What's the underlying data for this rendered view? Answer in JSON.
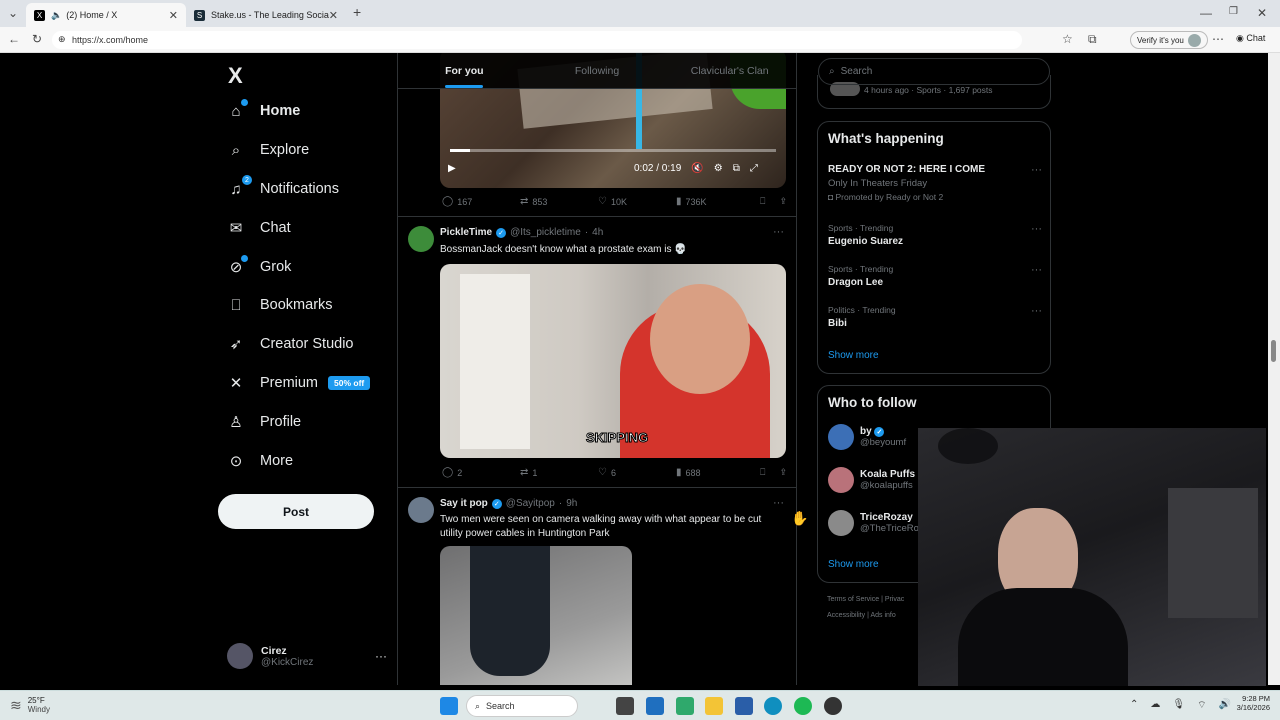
{
  "browser": {
    "tabs": [
      {
        "title": "(2) Home / X",
        "icon": "x-logo-icon"
      },
      {
        "title": "Stake.us - The Leading Social Casi...",
        "icon": "stake-icon"
      }
    ],
    "url": "https://x.com/home",
    "verify_label": "Verify it's you",
    "chat_label": "Chat"
  },
  "nav": {
    "logo": "X",
    "items": [
      {
        "label": "Home",
        "icon": "home-icon"
      },
      {
        "label": "Explore",
        "icon": "search-icon"
      },
      {
        "label": "Notifications",
        "icon": "bell-icon",
        "badge": "2"
      },
      {
        "label": "Chat",
        "icon": "mail-icon"
      },
      {
        "label": "Grok",
        "icon": "grok-icon"
      },
      {
        "label": "Bookmarks",
        "icon": "bookmark-icon"
      },
      {
        "label": "Creator Studio",
        "icon": "rocket-icon"
      },
      {
        "label": "Premium",
        "icon": "x-icon",
        "tag": "50% off"
      },
      {
        "label": "Profile",
        "icon": "person-icon"
      },
      {
        "label": "More",
        "icon": "more-circle-icon"
      }
    ],
    "post_label": "Post",
    "account": {
      "name": "Cirez",
      "handle": "@KickCirez"
    }
  },
  "feed": {
    "tabs": [
      "For you",
      "Following",
      "Clavicular's Clan"
    ],
    "video_time": "0:02 / 0:19",
    "posts": [
      {
        "stats": {
          "replies": "167",
          "reposts": "853",
          "likes": "10K",
          "views": "736K"
        }
      },
      {
        "name": "PickleTime",
        "handle": "@Its_pickletime",
        "time": "4h",
        "text": "BossmanJack doesn't know what a prostate exam is 💀",
        "caption": "SKIPPING",
        "stats": {
          "replies": "2",
          "reposts": "1",
          "likes": "6",
          "views": "688"
        }
      },
      {
        "name": "Say it pop",
        "handle": "@Sayitpop",
        "time": "9h",
        "text": "Two men were seen on camera walking away with what appear to be cut utility power cables in Huntington Park"
      }
    ]
  },
  "right": {
    "search_placeholder": "Search",
    "top_meta": "4 hours ago · Sports · 1,697 posts",
    "happening_title": "What's happening",
    "trends": [
      {
        "meta": "",
        "name": "READY OR NOT 2: HERE I COME",
        "sub": "Only In Theaters Friday",
        "promo": "Promoted by Ready or Not 2"
      },
      {
        "meta": "Sports · Trending",
        "name": "Eugenio Suarez"
      },
      {
        "meta": "Sports · Trending",
        "name": "Dragon Lee"
      },
      {
        "meta": "Politics · Trending",
        "name": "Bibi"
      }
    ],
    "show_more": "Show more",
    "wtf_title": "Who to follow",
    "follow": [
      {
        "name": "by",
        "handle": "@beyoumf"
      },
      {
        "name": "Koala Puffs",
        "handle": "@koalapuffs"
      },
      {
        "name": "TriceRozay",
        "handle": "@TheTriceRo"
      }
    ],
    "footer": [
      "Terms of Service",
      "Privac",
      "Accessibility",
      "Ads info"
    ]
  },
  "taskbar": {
    "weather_temp": "25°F",
    "weather_desc": "Windy",
    "search": "Search",
    "time": "9:28 PM",
    "date": "3/16/2026"
  },
  "colors": {
    "accent": "#1d9bf0",
    "bg": "#000000",
    "border": "#2f3336"
  }
}
